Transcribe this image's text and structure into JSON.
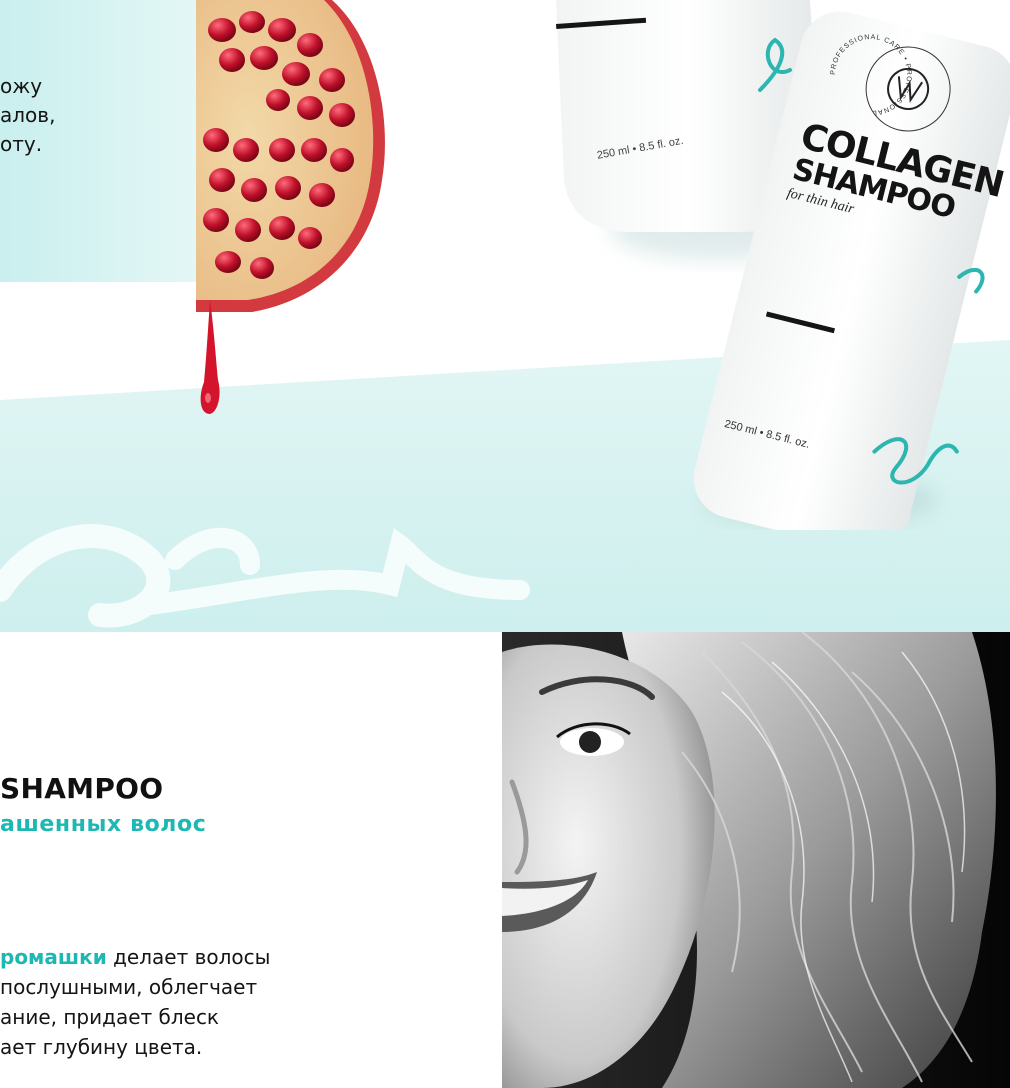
{
  "hero": {
    "intro_text": "ожу\nалов,\nоту.",
    "bottle_front": {
      "volume": "250 ml • 8.5 fl. oz."
    },
    "bottle_back": {
      "brand_line1": "COLLAGEN",
      "brand_line2": "SHAMPOO",
      "subtitle": "for thin hair",
      "volume": "250 ml • 8.5 fl. oz.",
      "seal_text": "PROFESSIONAL CARE • PROFESSIONAL"
    }
  },
  "product": {
    "title": "SHAMPOO",
    "subtitle": "ашенных волос",
    "description": {
      "highlight": "ромашки",
      "line1_rest": " делает волосы",
      "line2": " послушными, облегчает",
      "line3": "ание, придает блеск",
      "line4": "ает глубину цвета."
    }
  },
  "colors": {
    "accent": "#1eb8b3",
    "mint_background": "#d6f3f2",
    "text": "#151515"
  }
}
